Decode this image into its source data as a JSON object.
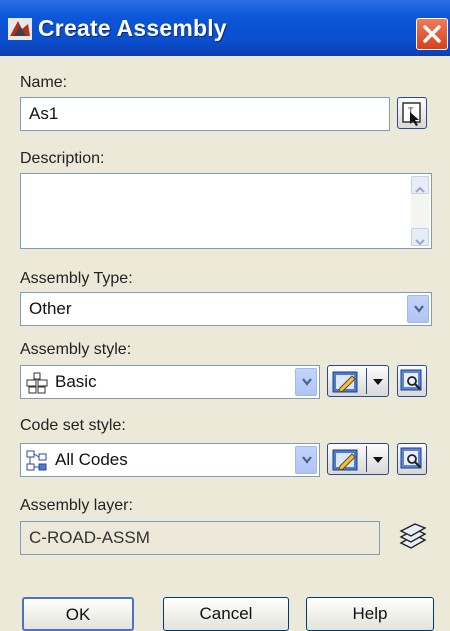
{
  "window": {
    "title": "Create Assembly",
    "title_icon": "autocad-icon",
    "close_icon": "close-icon"
  },
  "name": {
    "label": "Name:",
    "value": "As1",
    "pick_icon": "pick-from-drawing-icon"
  },
  "description": {
    "label": "Description:",
    "value": ""
  },
  "assembly_type": {
    "label": "Assembly Type:",
    "value": "Other"
  },
  "assembly_style": {
    "label": "Assembly style:",
    "value": "Basic",
    "icon": "assembly-style-icon"
  },
  "code_set_style": {
    "label": "Code set style:",
    "value": "All Codes",
    "icon": "code-set-icon"
  },
  "assembly_layer": {
    "label": "Assembly layer:",
    "value": "C-ROAD-ASSM",
    "icon": "layers-icon"
  },
  "buttons": {
    "ok": "OK",
    "cancel": "Cancel",
    "help": "Help"
  }
}
